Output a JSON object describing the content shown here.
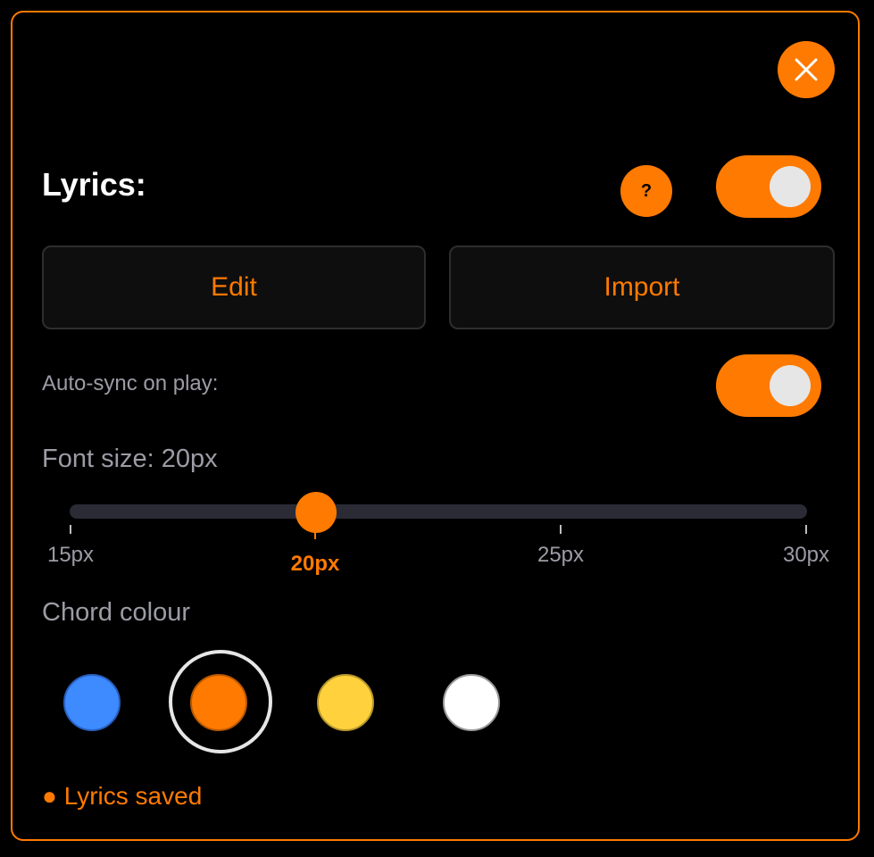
{
  "section": {
    "title": "Lyrics:",
    "help_label": "?",
    "lyrics_enabled": true
  },
  "buttons": {
    "edit_label": "Edit",
    "import_label": "Import"
  },
  "autosync": {
    "label": "Auto-sync on play:",
    "enabled": true
  },
  "font_size": {
    "label": "Font size: 20px",
    "value": 20,
    "min": 15,
    "max": 30,
    "ticks": [
      "15px",
      "20px",
      "25px",
      "30px"
    ]
  },
  "chord_colour": {
    "label": "Chord colour",
    "selected": "orange",
    "swatches": [
      {
        "name": "blue",
        "color": "#3d8bff"
      },
      {
        "name": "orange",
        "color": "#ff7a00"
      },
      {
        "name": "yellow",
        "color": "#ffd23d"
      },
      {
        "name": "white",
        "color": "#ffffff"
      }
    ]
  },
  "status": {
    "text": "● Lyrics saved"
  },
  "colors": {
    "accent": "#ff7a00",
    "background": "#000000",
    "muted_text": "#9c9ca6"
  }
}
